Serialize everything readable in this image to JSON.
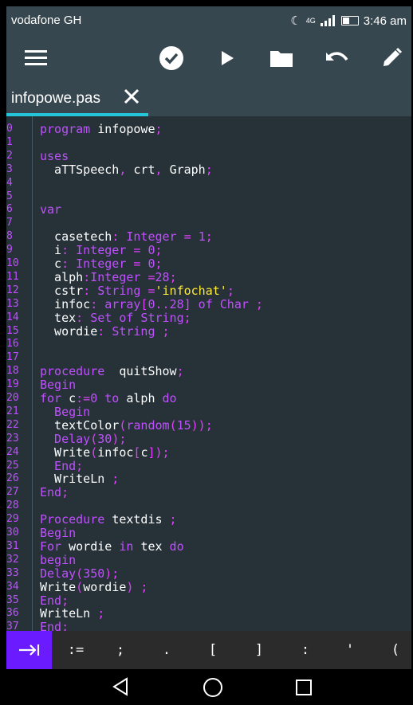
{
  "status_bar": {
    "carrier": "vodafone GH",
    "network": "4G",
    "time": "3:46 am"
  },
  "toolbar": {
    "icons": [
      "menu-icon",
      "check-icon",
      "play-icon",
      "folder-icon",
      "undo-icon",
      "pencil-icon"
    ]
  },
  "tab": {
    "filename": "infopowe.pas"
  },
  "editor": {
    "lines": [
      {
        "n": "0",
        "parts": [
          [
            "kw",
            "program "
          ],
          [
            "id",
            "infopowe"
          ],
          [
            "pu",
            ";"
          ]
        ]
      },
      {
        "n": "1",
        "parts": []
      },
      {
        "n": "2",
        "parts": [
          [
            "kw",
            "uses"
          ]
        ]
      },
      {
        "n": "3",
        "parts": [
          [
            "id",
            "  aTTSpeech"
          ],
          [
            "pu",
            ", "
          ],
          [
            "id",
            "crt"
          ],
          [
            "pu",
            ", "
          ],
          [
            "id",
            "Graph"
          ],
          [
            "pu",
            ";"
          ]
        ]
      },
      {
        "n": "4",
        "parts": []
      },
      {
        "n": "5",
        "parts": []
      },
      {
        "n": "6",
        "parts": [
          [
            "kw",
            "var"
          ]
        ]
      },
      {
        "n": "7",
        "parts": []
      },
      {
        "n": "8",
        "parts": [
          [
            "id",
            "  casetech"
          ],
          [
            "pu",
            ": "
          ],
          [
            "ty",
            "Integer"
          ],
          [
            "op",
            " = "
          ],
          [
            "nm",
            "1"
          ],
          [
            "pu",
            ";"
          ]
        ]
      },
      {
        "n": "9",
        "parts": [
          [
            "id",
            "  i"
          ],
          [
            "pu",
            ": "
          ],
          [
            "ty",
            "Integer"
          ],
          [
            "op",
            " = "
          ],
          [
            "nm",
            "0"
          ],
          [
            "pu",
            ";"
          ]
        ]
      },
      {
        "n": "10",
        "parts": [
          [
            "id",
            "  c"
          ],
          [
            "pu",
            ": "
          ],
          [
            "ty",
            "Integer"
          ],
          [
            "op",
            " = "
          ],
          [
            "nm",
            "0"
          ],
          [
            "pu",
            ";"
          ]
        ]
      },
      {
        "n": "11",
        "parts": [
          [
            "id",
            "  alph"
          ],
          [
            "pu",
            ":"
          ],
          [
            "ty",
            "Integer"
          ],
          [
            "op",
            " ="
          ],
          [
            "nm",
            "28"
          ],
          [
            "pu",
            ";"
          ]
        ]
      },
      {
        "n": "12",
        "parts": [
          [
            "id",
            "  cstr"
          ],
          [
            "pu",
            ": "
          ],
          [
            "ty",
            "String"
          ],
          [
            "op",
            " ="
          ],
          [
            "st",
            "'infochat'"
          ],
          [
            "pu",
            ";"
          ]
        ]
      },
      {
        "n": "13",
        "parts": [
          [
            "id",
            "  infoc"
          ],
          [
            "pu",
            ": "
          ],
          [
            "ty",
            "array"
          ],
          [
            "pu",
            "["
          ],
          [
            "nm",
            "0"
          ],
          [
            "pu",
            ".."
          ],
          [
            "nm",
            "28"
          ],
          [
            "pu",
            "]"
          ],
          [
            "kw",
            " of "
          ],
          [
            "ty",
            "Char"
          ],
          [
            "pu",
            " ;"
          ]
        ]
      },
      {
        "n": "14",
        "parts": [
          [
            "id",
            "  tex"
          ],
          [
            "pu",
            ": "
          ],
          [
            "ty",
            "Set of String"
          ],
          [
            "pu",
            ";"
          ]
        ]
      },
      {
        "n": "15",
        "parts": [
          [
            "id",
            "  wordie"
          ],
          [
            "pu",
            ": "
          ],
          [
            "ty",
            "String"
          ],
          [
            "pu",
            " ;"
          ]
        ]
      },
      {
        "n": "16",
        "parts": []
      },
      {
        "n": "17",
        "parts": []
      },
      {
        "n": "18",
        "parts": [
          [
            "kw",
            "procedure  "
          ],
          [
            "id",
            "quitShow"
          ],
          [
            "pu",
            ";"
          ]
        ]
      },
      {
        "n": "19",
        "parts": [
          [
            "kw",
            "Begin"
          ]
        ]
      },
      {
        "n": "20",
        "parts": [
          [
            "kw",
            "for "
          ],
          [
            "id",
            "c"
          ],
          [
            "op",
            ":="
          ],
          [
            "nm",
            "0"
          ],
          [
            "kw",
            " to "
          ],
          [
            "id",
            "alph"
          ],
          [
            "kw",
            " do"
          ]
        ]
      },
      {
        "n": "21",
        "parts": [
          [
            "kw",
            "  Begin"
          ]
        ]
      },
      {
        "n": "22",
        "parts": [
          [
            "id",
            "  textColor"
          ],
          [
            "pu",
            "("
          ],
          [
            "ty",
            "random"
          ],
          [
            "pu",
            "("
          ],
          [
            "nm",
            "15"
          ],
          [
            "pu",
            "));"
          ]
        ]
      },
      {
        "n": "23",
        "parts": [
          [
            "kw",
            "  Delay"
          ],
          [
            "pu",
            "("
          ],
          [
            "nm",
            "30"
          ],
          [
            "pu",
            ");"
          ]
        ]
      },
      {
        "n": "24",
        "parts": [
          [
            "id",
            "  Write"
          ],
          [
            "pu",
            "("
          ],
          [
            "id",
            "infoc"
          ],
          [
            "pu",
            "["
          ],
          [
            "id",
            "c"
          ],
          [
            "pu",
            "]);"
          ]
        ]
      },
      {
        "n": "25",
        "parts": [
          [
            "kw",
            "  End"
          ],
          [
            "pu",
            ";"
          ]
        ]
      },
      {
        "n": "26",
        "parts": [
          [
            "id",
            "  WriteLn"
          ],
          [
            "pu",
            " ;"
          ]
        ]
      },
      {
        "n": "27",
        "parts": [
          [
            "kw",
            "End"
          ],
          [
            "pu",
            ";"
          ]
        ]
      },
      {
        "n": "28",
        "parts": []
      },
      {
        "n": "29",
        "parts": [
          [
            "kw",
            "Procedure "
          ],
          [
            "id",
            "textdis"
          ],
          [
            "pu",
            " ;"
          ]
        ]
      },
      {
        "n": "30",
        "parts": [
          [
            "kw",
            "Begin"
          ]
        ]
      },
      {
        "n": "31",
        "parts": [
          [
            "kw",
            "For "
          ],
          [
            "id",
            "wordie"
          ],
          [
            "kw",
            " in "
          ],
          [
            "id",
            "tex"
          ],
          [
            "kw",
            " do"
          ]
        ]
      },
      {
        "n": "32",
        "parts": [
          [
            "kw",
            "begin"
          ]
        ]
      },
      {
        "n": "33",
        "parts": [
          [
            "kw",
            "Delay"
          ],
          [
            "pu",
            "("
          ],
          [
            "nm",
            "350"
          ],
          [
            "pu",
            ");"
          ]
        ]
      },
      {
        "n": "34",
        "parts": [
          [
            "id",
            "Write"
          ],
          [
            "pu",
            "("
          ],
          [
            "id",
            "wordie"
          ],
          [
            "pu",
            ") ;"
          ]
        ]
      },
      {
        "n": "35",
        "parts": [
          [
            "kw",
            "End"
          ],
          [
            "pu",
            ";"
          ]
        ]
      },
      {
        "n": "36",
        "parts": [
          [
            "id",
            "WriteLn"
          ],
          [
            "pu",
            " ;"
          ]
        ]
      },
      {
        "n": "37",
        "parts": [
          [
            "kw",
            "End"
          ],
          [
            "pu",
            ";"
          ]
        ]
      }
    ]
  },
  "symbol_bar": {
    "symbols": [
      ":=",
      ";",
      ".",
      "[",
      "]",
      ":",
      "'",
      "("
    ]
  },
  "colors": {
    "accent": "#26c6da",
    "tab_key": "#6a1bff",
    "keyword": "#c050ff",
    "string": "#ffeb3b"
  }
}
